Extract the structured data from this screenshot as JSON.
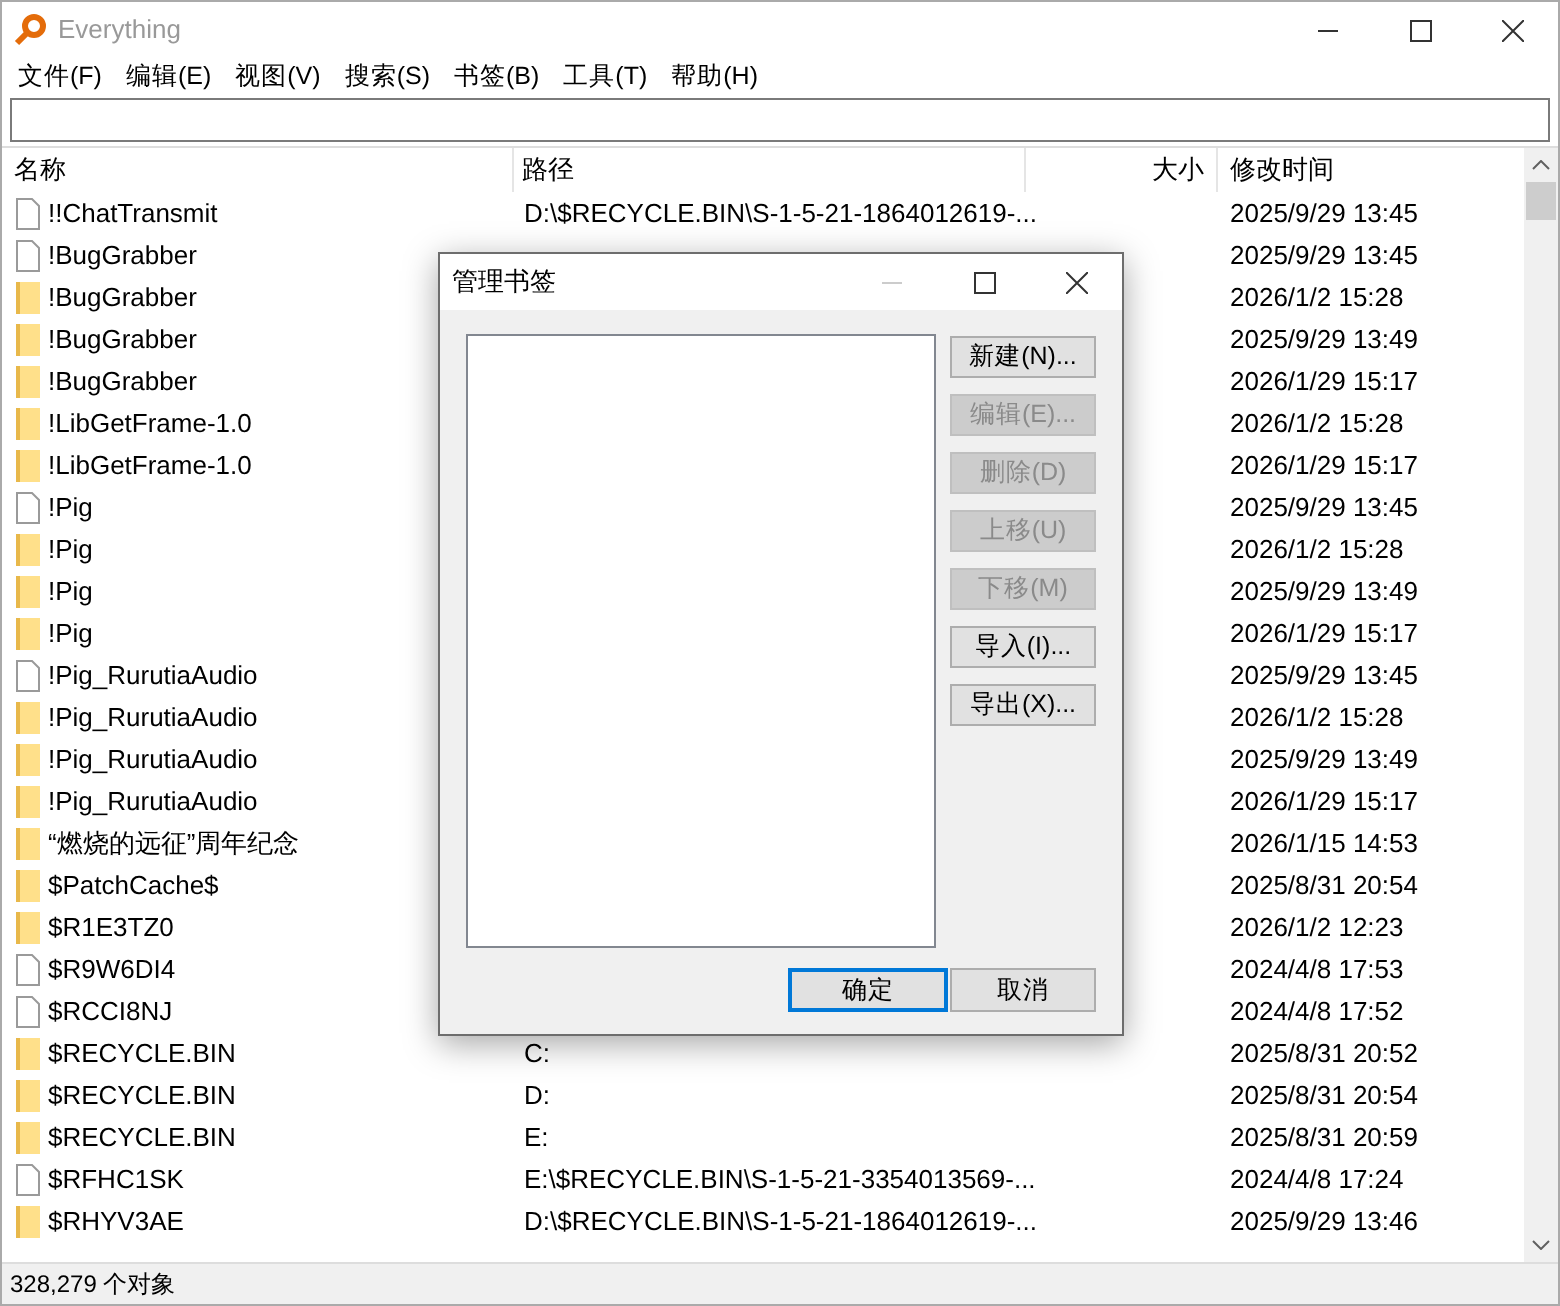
{
  "window": {
    "title": "Everything"
  },
  "menu": [
    "文件(F)",
    "编辑(E)",
    "视图(V)",
    "搜索(S)",
    "书签(B)",
    "工具(T)",
    "帮助(H)"
  ],
  "columns": [
    "名称",
    "路径",
    "大小",
    "修改时间"
  ],
  "rows": [
    {
      "kind": "file",
      "name": "!!ChatTransmit",
      "path": "D:\\$RECYCLE.BIN\\S-1-5-21-1864012619-...",
      "modified": "2025/9/29 13:45"
    },
    {
      "kind": "file",
      "name": "!BugGrabber",
      "modified": "2025/9/29 13:45"
    },
    {
      "kind": "folder",
      "name": "!BugGrabber",
      "modified": "2026/1/2 15:28"
    },
    {
      "kind": "folder",
      "name": "!BugGrabber",
      "modified": "2025/9/29 13:49"
    },
    {
      "kind": "folder",
      "name": "!BugGrabber",
      "modified": "2026/1/29 15:17"
    },
    {
      "kind": "folder",
      "name": "!LibGetFrame-1.0",
      "modified": "2026/1/2 15:28"
    },
    {
      "kind": "folder",
      "name": "!LibGetFrame-1.0",
      "modified": "2026/1/29 15:17"
    },
    {
      "kind": "file",
      "name": "!Pig",
      "modified": "2025/9/29 13:45"
    },
    {
      "kind": "folder",
      "name": "!Pig",
      "modified": "2026/1/2 15:28"
    },
    {
      "kind": "folder",
      "name": "!Pig",
      "modified": "2025/9/29 13:49"
    },
    {
      "kind": "folder",
      "name": "!Pig",
      "modified": "2026/1/29 15:17"
    },
    {
      "kind": "file",
      "name": "!Pig_RurutiaAudio",
      "modified": "2025/9/29 13:45"
    },
    {
      "kind": "folder",
      "name": "!Pig_RurutiaAudio",
      "modified": "2026/1/2 15:28"
    },
    {
      "kind": "folder",
      "name": "!Pig_RurutiaAudio",
      "modified": "2025/9/29 13:49"
    },
    {
      "kind": "folder",
      "name": "!Pig_RurutiaAudio",
      "modified": "2026/1/29 15:17"
    },
    {
      "kind": "folder",
      "name": "“燃烧的远征”周年纪念",
      "modified": "2026/1/15 14:53"
    },
    {
      "kind": "folder",
      "name": "$PatchCache$",
      "modified": "2025/8/31 20:54"
    },
    {
      "kind": "folder",
      "name": "$R1E3TZ0",
      "modified": "2026/1/2 12:23"
    },
    {
      "kind": "file",
      "name": "$R9W6DI4",
      "modified": "2024/4/8 17:53"
    },
    {
      "kind": "file",
      "name": "$RCCI8NJ",
      "modified": "2024/4/8 17:52"
    },
    {
      "kind": "folder",
      "name": "$RECYCLE.BIN",
      "path": "C:",
      "modified": "2025/8/31 20:52"
    },
    {
      "kind": "folder",
      "name": "$RECYCLE.BIN",
      "path": "D:",
      "modified": "2025/8/31 20:54"
    },
    {
      "kind": "folder",
      "name": "$RECYCLE.BIN",
      "path": "E:",
      "modified": "2025/8/31 20:59"
    },
    {
      "kind": "file",
      "name": "$RFHC1SK",
      "path": "E:\\$RECYCLE.BIN\\S-1-5-21-3354013569-...",
      "modified": "2024/4/8 17:24"
    },
    {
      "kind": "folder",
      "name": "$RHYV3AE",
      "path": "D:\\$RECYCLE.BIN\\S-1-5-21-1864012619-...",
      "modified": "2025/9/29 13:46"
    }
  ],
  "status_bar": "328,279 个对象",
  "dialog": {
    "title": "管理书签",
    "side_buttons": [
      {
        "label": "新建(N)...",
        "disabled": false
      },
      {
        "label": "编辑(E)...",
        "disabled": true
      },
      {
        "label": "删除(D)",
        "disabled": true
      },
      {
        "label": "上移(U)",
        "disabled": true
      },
      {
        "label": "下移(M)",
        "disabled": true
      },
      {
        "label": "导入(I)...",
        "disabled": false
      },
      {
        "label": "导出(X)...",
        "disabled": false
      }
    ],
    "footer_buttons": [
      {
        "label": "确定",
        "default": true
      },
      {
        "label": "取消",
        "default": false
      }
    ]
  }
}
